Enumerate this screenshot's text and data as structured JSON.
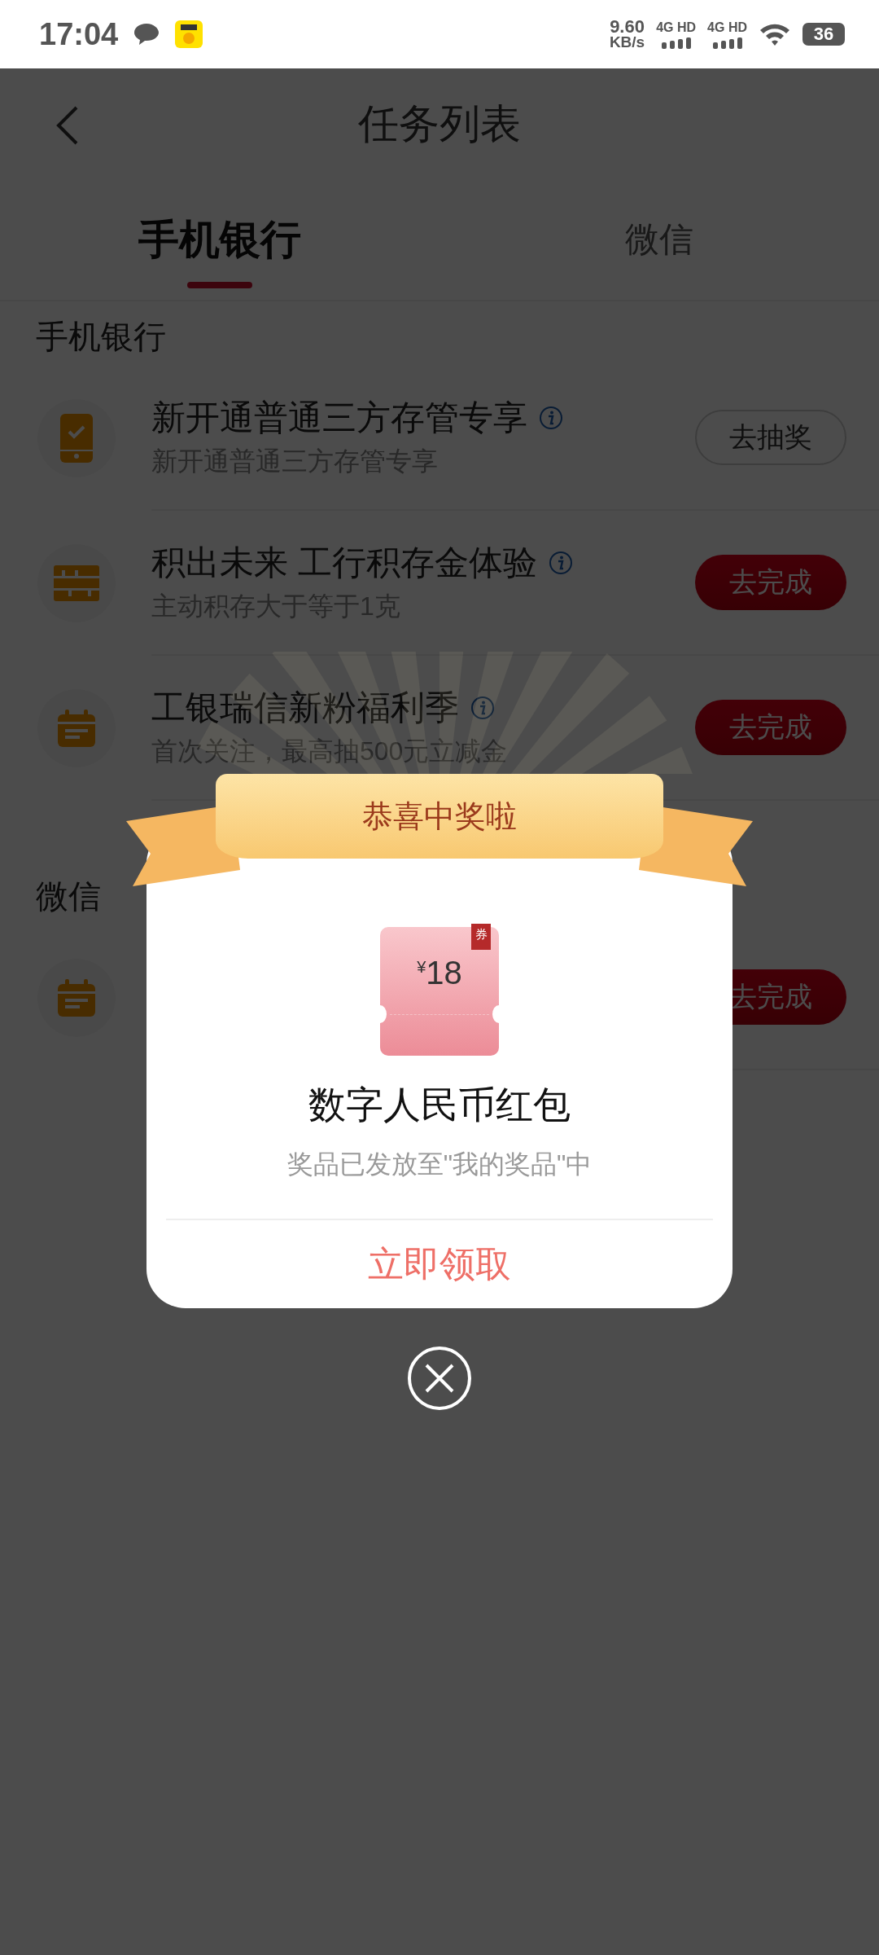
{
  "status_bar": {
    "time": "17:04",
    "net_speed": "9.60",
    "net_unit": "KB/s",
    "networks": [
      "4G HD",
      "4G HD"
    ],
    "battery": "36"
  },
  "header": {
    "title": "任务列表"
  },
  "tabs": [
    {
      "label": "手机银行",
      "selected": true
    },
    {
      "label": "微信",
      "selected": false
    }
  ],
  "sections": [
    {
      "title": "手机银行",
      "tasks": [
        {
          "kind": "phone",
          "title": "新开通普通三方存管专享",
          "subtitle": "新开通普通三方存管专享",
          "button": "去抽奖",
          "primary": false
        },
        {
          "kind": "abacus",
          "title": "积出未来 工行积存金体验",
          "subtitle": "主动积存大于等于1克",
          "button": "去完成",
          "primary": true
        },
        {
          "kind": "calendar",
          "title": "工银瑞信新粉福利季",
          "subtitle": "首次关注，最高抽500元立减金",
          "button": "去完成",
          "primary": true
        }
      ]
    },
    {
      "title": "微信",
      "tasks": [
        {
          "kind": "calendar",
          "button": "去完成",
          "primary": true
        }
      ]
    }
  ],
  "dialog": {
    "title": "恭喜中奖啦",
    "coupon": {
      "currency": "¥",
      "amount": "18",
      "tag": "券"
    },
    "prize_name": "数字人民币红包",
    "note": "奖品已发放至\"我的奖品\"中",
    "action": "立即领取"
  }
}
